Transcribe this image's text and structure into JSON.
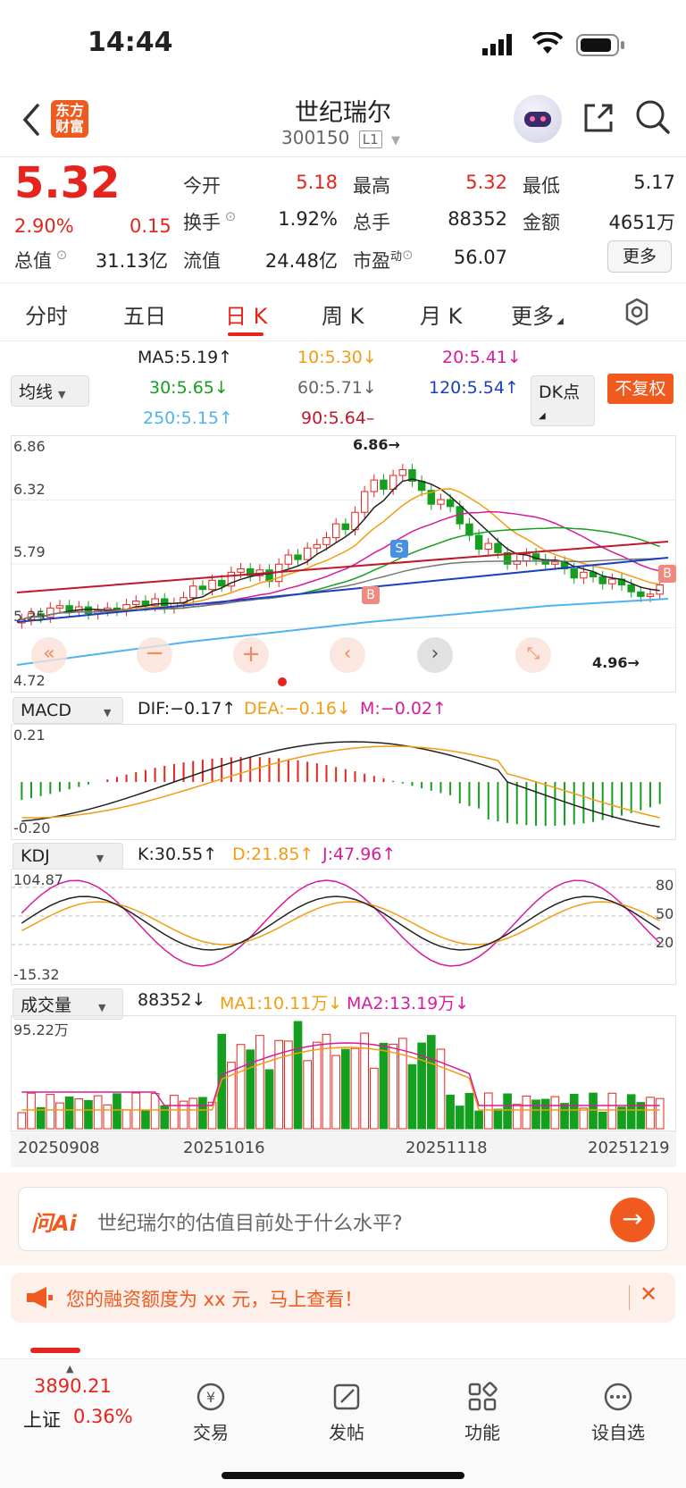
{
  "status_bar": {
    "time": "14:44"
  },
  "header": {
    "logo_text": "东方财富",
    "stock_name": "世纪瑞尔",
    "stock_code": "300150",
    "level_badge": "L1"
  },
  "quote": {
    "price": "5.32",
    "change_pct": "2.90%",
    "change_amt": "0.15",
    "cells": [
      {
        "label": "今开",
        "value": "5.18",
        "color": "red"
      },
      {
        "label": "最高",
        "value": "5.32",
        "color": "red"
      },
      {
        "label": "最低",
        "value": "5.17",
        "color": "dark"
      },
      {
        "label": "换手",
        "value": "1.92%",
        "color": "dark"
      },
      {
        "label": "总手",
        "value": "88352",
        "color": "dark"
      },
      {
        "label": "金额",
        "value": "4651万",
        "color": "dark"
      }
    ],
    "row3": {
      "total_value_label": "总值",
      "total_value": "31.13亿",
      "float_value_label": "流值",
      "float_value": "24.48亿",
      "pe_label": "市盈",
      "pe_sup": "动",
      "pe_value": "56.07",
      "more_button": "更多"
    }
  },
  "tabs": [
    "分时",
    "五日",
    "日 K",
    "周 K",
    "月 K",
    "更多"
  ],
  "active_tab": "日 K",
  "ma_legend": {
    "selector": "均线",
    "items": [
      {
        "text": "MA5:5.19↑",
        "color": "#222222"
      },
      {
        "text": "10:5.30↓",
        "color": "#f39c12"
      },
      {
        "text": "20:5.41↓",
        "color": "#d81b9a"
      },
      {
        "text": "30:5.65↓",
        "color": "#14a01e"
      },
      {
        "text": "60:5.71↓",
        "color": "#666666"
      },
      {
        "text": "120:5.54↑",
        "color": "#1a3fbf"
      },
      {
        "text": "250:5.15↑",
        "color": "#4fb3f0"
      },
      {
        "text": "90:5.64–",
        "color": "#c0182a"
      }
    ],
    "dk_button": "DK点",
    "adjust_button": "不复权"
  },
  "kline": {
    "y_labels": [
      "6.86",
      "6.32",
      "5.79",
      "5.25",
      "4.72"
    ],
    "high_marker": "6.86→",
    "low_marker": "4.96→",
    "marker_b": "B",
    "marker_s": "S"
  },
  "macd": {
    "selector": "MACD",
    "dif": "DIF:−0.17↑",
    "dea": "DEA:−0.16↓",
    "m": "M:−0.02↑",
    "top": "0.21",
    "bottom": "-0.20"
  },
  "kdj": {
    "selector": "KDJ",
    "k": "K:30.55↑",
    "d": "D:21.85↑",
    "j": "J:47.96↑",
    "top": "104.87",
    "bottom": "-15.32",
    "levels": [
      "80",
      "50",
      "20"
    ]
  },
  "volume": {
    "selector": "成交量",
    "vol": "88352↓",
    "ma1": "MA1:10.11万↓",
    "ma2": "MA2:13.19万↓",
    "top": "95.22万",
    "dates": [
      "20250908",
      "20251016",
      "20251118",
      "20251219"
    ]
  },
  "ai": {
    "logo": "问Ai",
    "prompt": "世纪瑞尔的估值目前处于什么水平?"
  },
  "promo": {
    "text": "您的融资额度为 xx 元，马上查看！"
  },
  "bottom": {
    "index_value": "3890.21",
    "index_name": "上证",
    "index_pct": "0.36%",
    "items": [
      {
        "label": "交易",
        "icon": "trade-icon"
      },
      {
        "label": "发帖",
        "icon": "post-icon"
      },
      {
        "label": "功能",
        "icon": "function-icon"
      },
      {
        "label": "设自选",
        "icon": "favorite-icon"
      }
    ]
  },
  "colors": {
    "up": "#e5241d",
    "down": "#14a01e",
    "accent": "#f05a1e"
  }
}
